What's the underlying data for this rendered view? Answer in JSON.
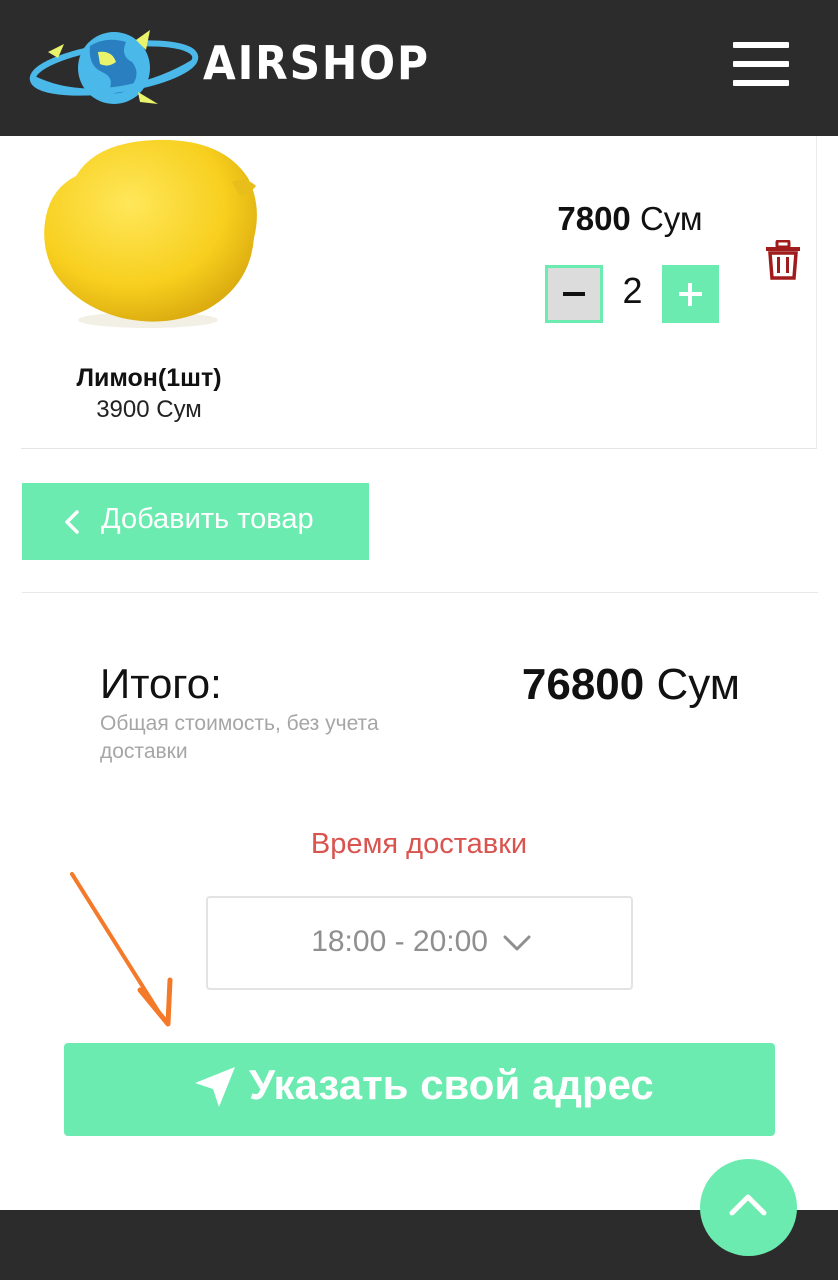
{
  "header": {
    "brand": "AIRSHOP",
    "menu_icon": "hamburger-menu-icon"
  },
  "cart_item": {
    "name": "Лимон(1шт)",
    "unit_price": "3900 Сум",
    "line_total_value": "7800",
    "line_total_currency": "Сум",
    "quantity": "2",
    "minus_icon": "minus-icon",
    "plus_icon": "plus-icon",
    "delete_icon": "trash-icon"
  },
  "add_product_button": {
    "label": "Добавить товар",
    "icon": "chevron-left-icon"
  },
  "summary": {
    "total_label": "Итого:",
    "total_note": "Общая стоимость, без учета доставки",
    "total_value": "76800",
    "total_currency": "Сум"
  },
  "delivery": {
    "label": "Время доставки",
    "selected_time": "18:00 - 20:00"
  },
  "address_button": {
    "label": "Указать свой адрес",
    "icon": "navigation-arrow-icon"
  },
  "scroll_top_icon": "chevron-up-icon",
  "colors": {
    "header_bg": "#2c2c2c",
    "accent": "#6cebb0",
    "delivery_label": "#d9534f",
    "trash": "#a01c1c",
    "annotation_arrow": "#f47a2a"
  }
}
